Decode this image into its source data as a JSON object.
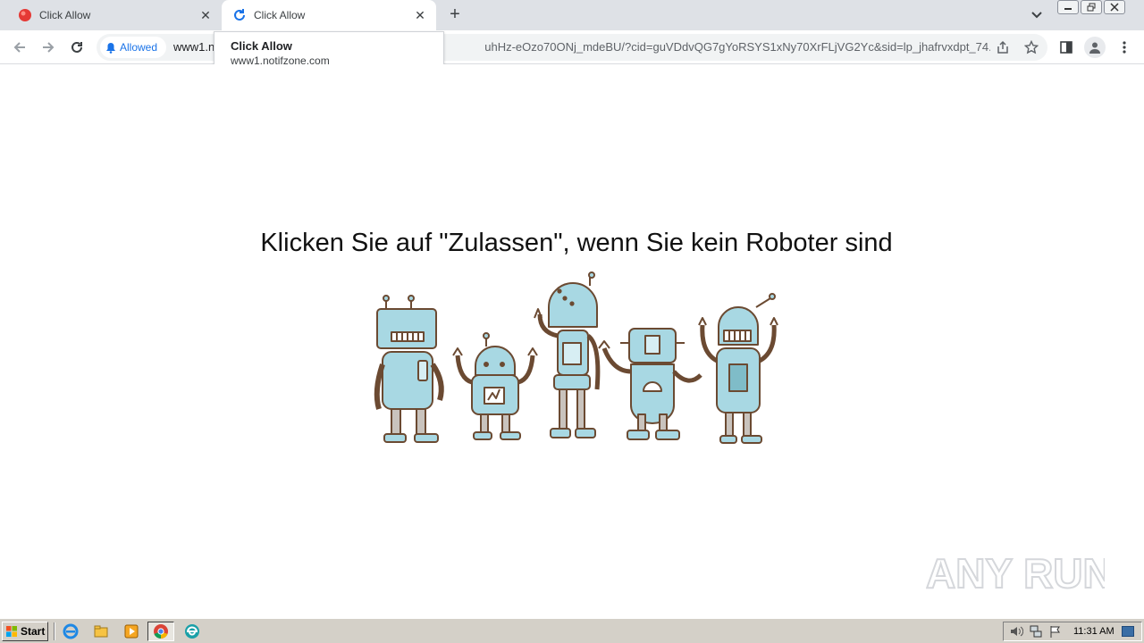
{
  "browser": {
    "tabs": [
      {
        "title": "Click Allow",
        "favicon": "red-circle-icon",
        "active": false
      },
      {
        "title": "Click Allow",
        "favicon": "loading-reload-icon",
        "active": true
      }
    ],
    "new_tab_label": "+",
    "tab_close_label": "✕",
    "permission_chip": "Allowed",
    "url_prefix": "www1.n",
    "url_rest": "uhHz-eOzo70ONj_mdeBU/?cid=guVDdvQG7gYoRSYS1xNy70XrFLjVG2Yc&sid=lp_jhafrvxdpt_74...",
    "tooltip": {
      "title": "Click Allow",
      "host": "www1.notifzone.com"
    }
  },
  "page": {
    "headline": "Klicken Sie auf \"Zulassen\", wenn Sie kein Roboter sind"
  },
  "watermark": {
    "text": "ANY RUN"
  },
  "taskbar": {
    "start_label": "Start",
    "clock": "11:31 AM"
  },
  "colors": {
    "robot_fill": "#a8d8e3",
    "robot_stroke": "#6b4a32",
    "accent_blue": "#1a73e8",
    "tab_strip": "#dee1e6"
  }
}
